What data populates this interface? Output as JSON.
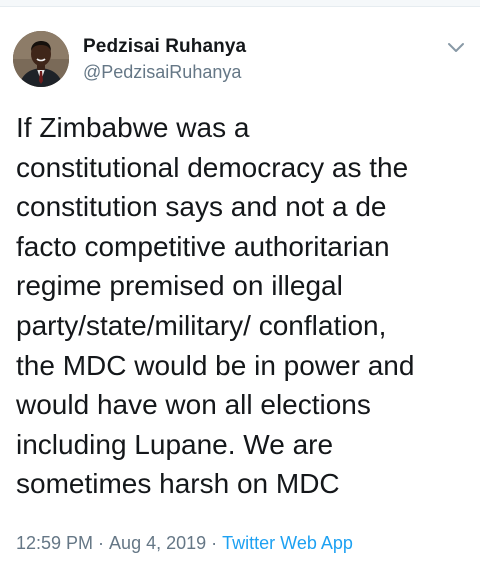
{
  "author": {
    "name": "Pedzisai Ruhanya",
    "handle": "@PedzisaiRuhanya"
  },
  "tweet": {
    "text": "If Zimbabwe was a\nconstitutional democracy as the\nconstitution says and not a de\nfacto competitive authoritarian\nregime premised on illegal\nparty/state/military/ conflation,\nthe MDC would be in power and\nwould have won all elections\nincluding Lupane. We are\nsometimes harsh on MDC",
    "time": "12:59 PM",
    "separator1": "·",
    "date": "Aug 4, 2019",
    "separator2": "·",
    "source": "Twitter Web App"
  },
  "icons": {
    "caret": "chevron-down-icon",
    "avatar": "profile-photo"
  },
  "colors": {
    "text": "#14171a",
    "muted": "#657786",
    "link": "#1da1f2"
  }
}
